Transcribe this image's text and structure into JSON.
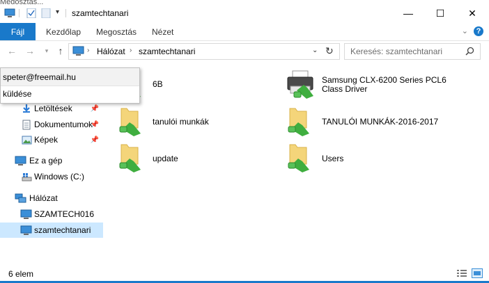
{
  "window": {
    "title": "szamtechtanari",
    "controls": {
      "minimize": "—",
      "maximize": "☐",
      "close": "✕"
    },
    "top_fragment": "Megosztás..."
  },
  "ribbon": {
    "file_tab": "Fájl",
    "tabs": [
      "Kezdőlap",
      "Megosztás",
      "Nézet"
    ],
    "help": "?"
  },
  "nav": {
    "breadcrumb": [
      "Hálózat",
      "szamtechtanari"
    ],
    "search_placeholder": "Keresés: szamtechtanari"
  },
  "popup": {
    "email": "speter@freemail.hu",
    "action": "küldése"
  },
  "sidebar": {
    "items": [
      {
        "label": "Letöltések",
        "icon": "download-icon",
        "pinned": true
      },
      {
        "label": "Dokumentumok",
        "icon": "documents-icon",
        "pinned": true
      },
      {
        "label": "Képek",
        "icon": "pictures-icon",
        "pinned": true
      },
      {
        "label": "Ez a gép",
        "icon": "computer-icon",
        "pinned": false
      },
      {
        "label": "Windows (C:)",
        "icon": "drive-icon",
        "pinned": false
      },
      {
        "label": "Hálózat",
        "icon": "network-icon",
        "pinned": false
      },
      {
        "label": "SZAMTECH016",
        "icon": "computer-icon",
        "pinned": false
      },
      {
        "label": "szamtechtanari",
        "icon": "computer-icon",
        "pinned": false,
        "selected": true
      }
    ]
  },
  "content": {
    "items": [
      {
        "label": "6B",
        "type": "share"
      },
      {
        "label": "Samsung CLX-6200 Series PCL6 Class Driver",
        "label_lines": [
          "Samsung CLX-6200 Series PCL6",
          "Class Driver"
        ],
        "type": "printer"
      },
      {
        "label": "tanulói munkák",
        "type": "share"
      },
      {
        "label": "TANULÓI MUNKÁK-2016-2017",
        "type": "share"
      },
      {
        "label": "update",
        "type": "share"
      },
      {
        "label": "Users",
        "type": "share"
      }
    ]
  },
  "status": {
    "count": "6 elem"
  },
  "colors": {
    "accent": "#1979ca",
    "selection": "#cce8ff",
    "folder": "#f4d57a",
    "network_green": "#3fae3f"
  }
}
